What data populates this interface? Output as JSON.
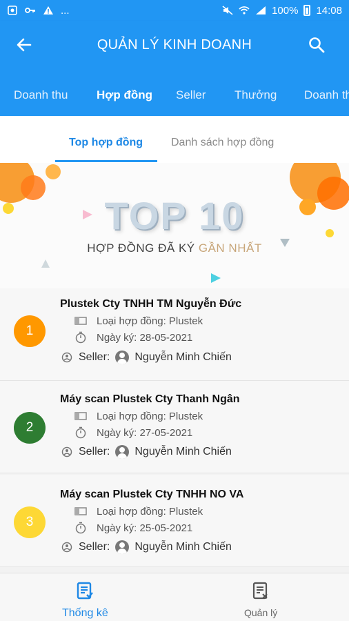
{
  "status_bar": {
    "battery": "100%",
    "time": "14:08",
    "ellipsis": "..."
  },
  "app_bar": {
    "title": "QUẢN LÝ KINH DOANH"
  },
  "tabs": [
    {
      "label": "Doanh thu",
      "active": false
    },
    {
      "label": "Hợp đồng",
      "active": true
    },
    {
      "label": "Seller",
      "active": false
    },
    {
      "label": "Thưởng",
      "active": false
    },
    {
      "label": "Doanh th",
      "active": false
    }
  ],
  "sub_tabs": [
    {
      "label": "Top hợp đồng",
      "active": true
    },
    {
      "label": "Danh sách hợp đồng",
      "active": false
    }
  ],
  "banner": {
    "headline": "TOP 10",
    "subline_main": "HỢP ĐỒNG ĐÃ KÝ ",
    "subline_highlight": "GẦN NHẤT"
  },
  "contracts": [
    {
      "rank": "1",
      "rank_color": "#ff9800",
      "title": "Plustek Cty TNHH TM Nguyễn Đức",
      "type_text": "Loại hợp đồng: Plustek",
      "date_text": "Ngày ký: 28-05-2021",
      "seller_label": "Seller:",
      "seller_name": "Nguyễn Minh Chiến"
    },
    {
      "rank": "2",
      "rank_color": "#2e7d32",
      "title": "Máy scan Plustek Cty Thanh Ngân",
      "type_text": "Loại hợp đồng: Plustek",
      "date_text": "Ngày ký: 27-05-2021",
      "seller_label": "Seller:",
      "seller_name": "Nguyễn Minh Chiến"
    },
    {
      "rank": "3",
      "rank_color": "#fdd835",
      "title": "Máy scan Plustek Cty TNHH NO VA",
      "type_text": "Loại hợp đồng: Plustek",
      "date_text": "Ngày ký: 25-05-2021",
      "seller_label": "Seller:",
      "seller_name": "Nguyễn Minh Chiến"
    }
  ],
  "bottom_nav": [
    {
      "label": "Thống kê",
      "icon": "report-icon",
      "active": true
    },
    {
      "label": "Quản lý",
      "icon": "manage-icon",
      "active": false
    }
  ],
  "colors": {
    "primary": "#2196f3",
    "active_text": "#1e88e5"
  }
}
